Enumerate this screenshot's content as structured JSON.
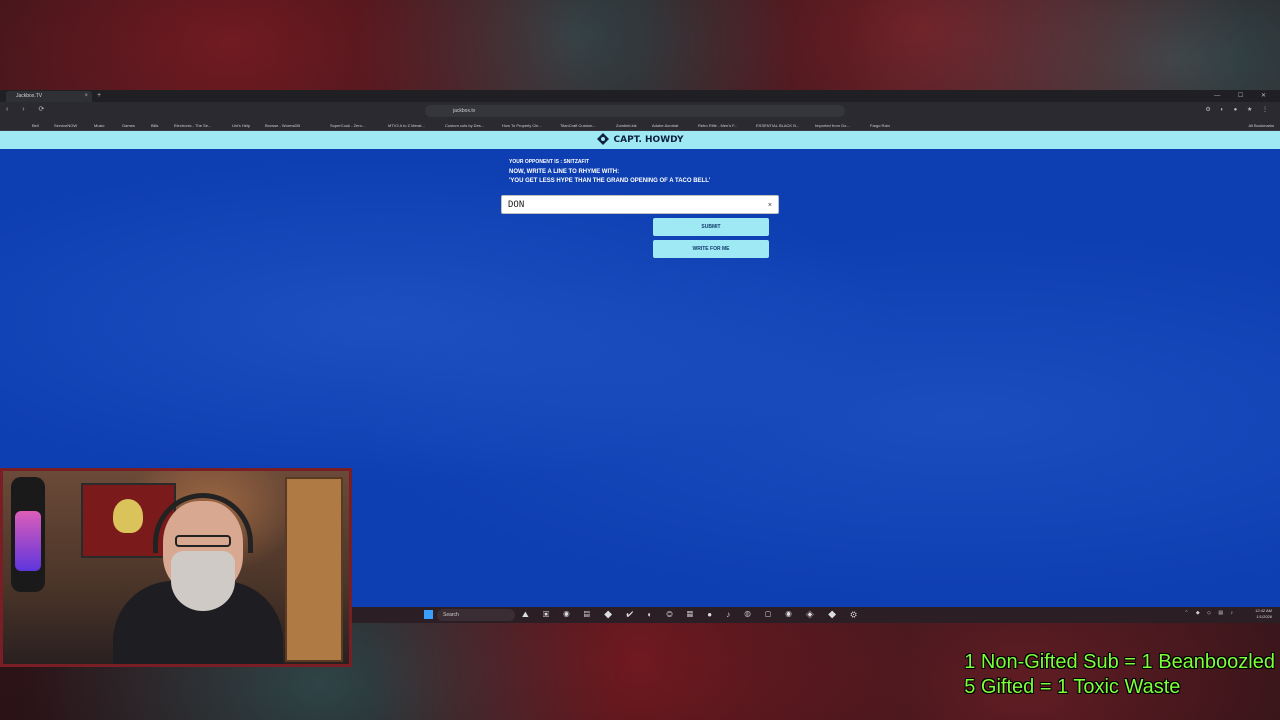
{
  "browser": {
    "tab_title": "Jackbox.TV",
    "tab_close": "×",
    "new_tab": "+",
    "window_controls": "— ☐ ✕",
    "nav": "‹ › ⟳",
    "url": "jackbox.tv",
    "extensions": "⚙ ◐ ● ★ ⋮",
    "bookmarks": [
      "Bell",
      "ServiceNOW",
      "Music",
      "Games",
      "Bills",
      "Electronic - The Se...",
      "Uni's Help",
      "Browse - WormsDB",
      "SuperCook - Zero...",
      "MTV2 A to Z Merat...",
      "Custom cuts by Des...",
      "How To Properly Cle...",
      "TitanCraft Custom...",
      "ZombieLink",
      "Adobe Acrobat",
      "Retro Rifle - Men's F...",
      "ESSENTIAL BLACK B...",
      "Imported from Go...",
      "Fargo Rain"
    ],
    "all_bookmarks": "All Bookmarks"
  },
  "game": {
    "player_name": "CAPT. HOWDY",
    "opponent_line": "YOUR OPPONENT IS : SNITZAFIT",
    "instruction": "NOW, WRITE A LINE TO RHYME WITH:",
    "quote": "'YOU GET LESS HYPE THAN THE GRAND OPENING OF A TACO BELL'",
    "answer_value": "DON",
    "clear_symbol": "×",
    "submit_label": "SUBMIT",
    "write_for_me_label": "WRITE FOR ME"
  },
  "taskbar": {
    "search_placeholder": "Search",
    "icons": "⛰ ▣ ◉ ▤ ◆ ✔ ◐ ◎ ▦ ● ♪ ◍ ▢ ◉ ◈ ◆ ⚙",
    "tray": "⌃ ◆ ◇ ▤ ♪",
    "time": "12:42 AM",
    "date": "1/1/2026"
  },
  "overlay": {
    "line1": "1 Non-Gifted Sub = 1 Beanboozled",
    "line2": "5 Gifted = 1 Toxic Waste"
  },
  "colors": {
    "page_blue": "#0e3fb2",
    "accent_cyan": "#9ee9f4",
    "overlay_green": "#7dff3a"
  }
}
